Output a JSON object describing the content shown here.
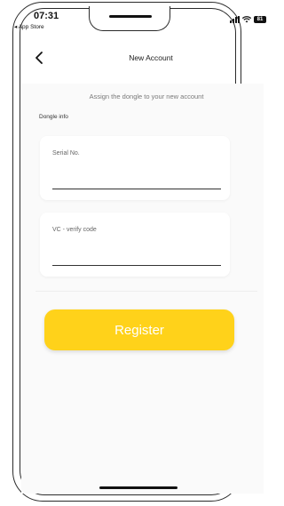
{
  "status_bar": {
    "time": "07:31",
    "back_to_app": "◂ App Store",
    "battery": "81"
  },
  "header": {
    "title": "New Account"
  },
  "main": {
    "subtitle": "Assign the dongle to your new account",
    "section_label": "Dongle info",
    "fields": [
      {
        "label": "Serial No.",
        "value": ""
      },
      {
        "label": "VC - verify code",
        "value": ""
      }
    ],
    "register_label": "Register"
  },
  "colors": {
    "accent": "#ffd21a"
  }
}
